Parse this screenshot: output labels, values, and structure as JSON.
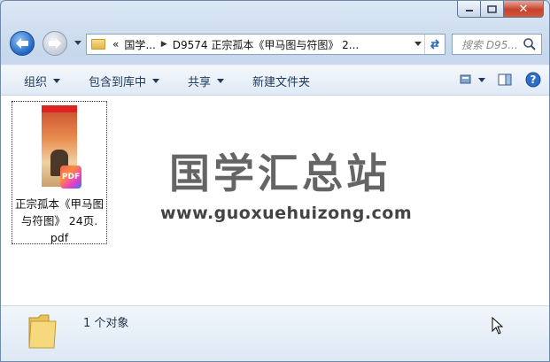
{
  "window": {
    "caption": {
      "minimize_icon": "minimize-icon",
      "maximize_icon": "maximize-icon",
      "close_icon": "close-icon",
      "close_glyph": "✕"
    }
  },
  "address_bar": {
    "overflow": "«",
    "crumbs": [
      "国学...",
      "D9574 正宗孤本《甲马图与符图》 2..."
    ],
    "search_placeholder": "搜索 D95..."
  },
  "toolbar": {
    "organize": "组织",
    "include_in_library": "包含到库中",
    "share": "共享",
    "new_folder": "新建文件夹"
  },
  "content": {
    "file": {
      "name_line1": "正宗孤本《甲马图",
      "name_line2": "与符图》 24页.",
      "name_line3": "pdf",
      "badge": "PDF"
    },
    "watermark": {
      "title": "国学汇总站",
      "url": "www.guoxuehuizong.com"
    }
  },
  "details": {
    "item_count": "1 个对象"
  },
  "colors": {
    "accent": "#1e65c2",
    "toolbar_text": "#1e395b",
    "close_button": "#c8412c"
  }
}
